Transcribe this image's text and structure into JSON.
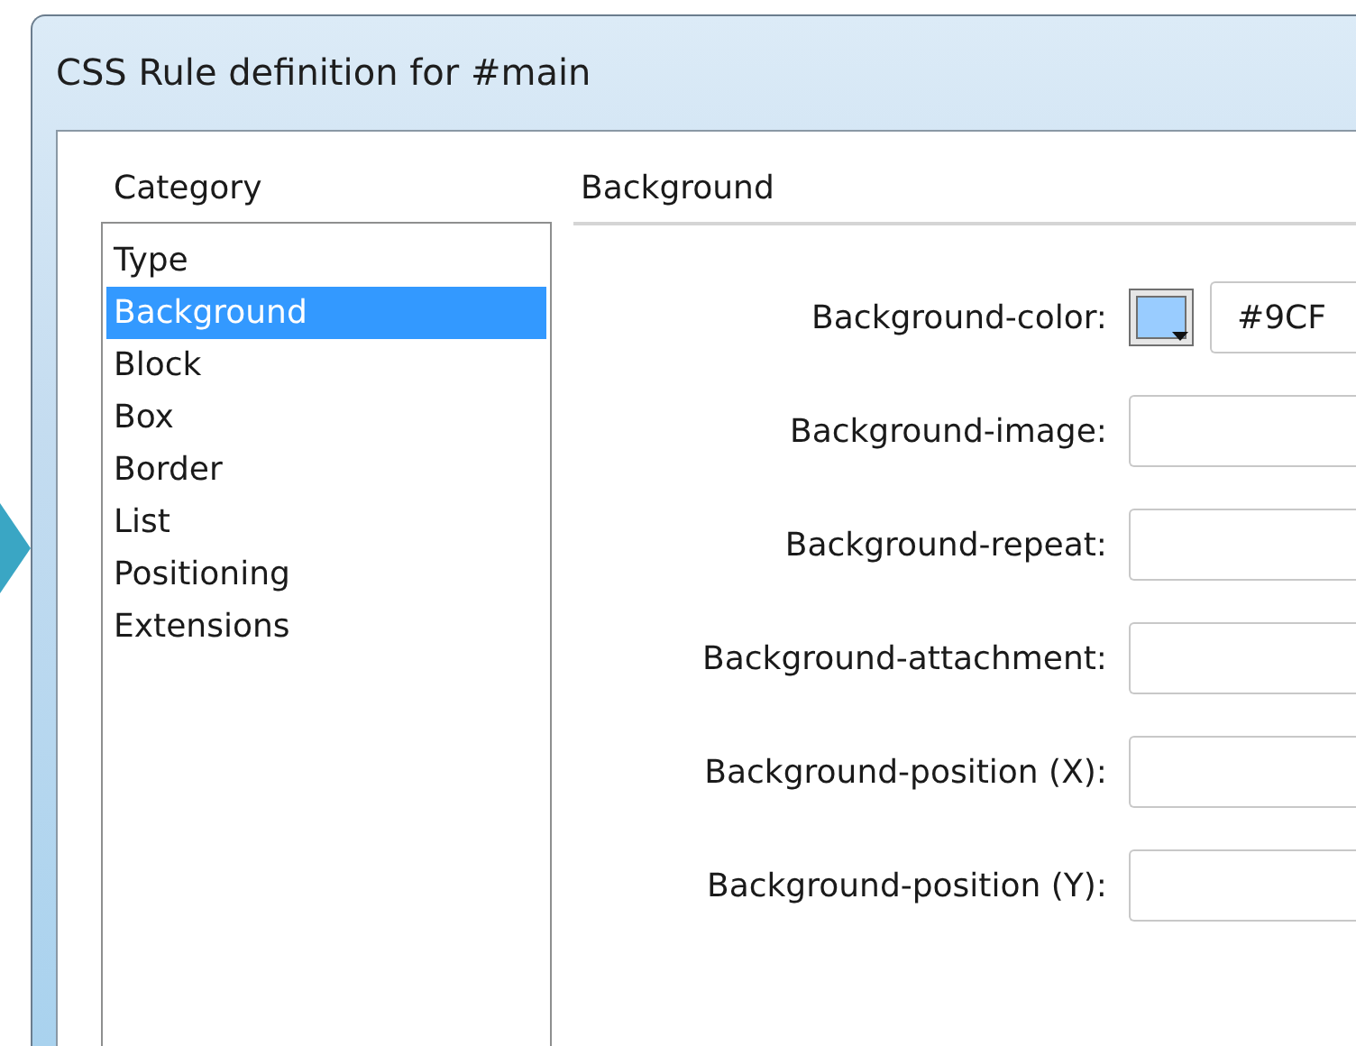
{
  "window": {
    "title": "CSS Rule definition for #main"
  },
  "category": {
    "label": "Category",
    "items": [
      {
        "label": "Type",
        "selected": false
      },
      {
        "label": "Background",
        "selected": true
      },
      {
        "label": "Block",
        "selected": false
      },
      {
        "label": "Box",
        "selected": false
      },
      {
        "label": "Border",
        "selected": false
      },
      {
        "label": "List",
        "selected": false
      },
      {
        "label": "Positioning",
        "selected": false
      },
      {
        "label": "Extensions",
        "selected": false
      }
    ]
  },
  "panel": {
    "title": "Background",
    "fields": [
      {
        "label": "Background-color:",
        "kind": "color",
        "color": "#99ccff",
        "value": "#9CF"
      },
      {
        "label": "Background-image:",
        "kind": "text"
      },
      {
        "label": "Background-repeat:",
        "kind": "text"
      },
      {
        "label": "Background-attachment:",
        "kind": "text"
      },
      {
        "label": "Background-position (X):",
        "kind": "text"
      },
      {
        "label": "Background-position (Y):",
        "kind": "text"
      }
    ]
  }
}
